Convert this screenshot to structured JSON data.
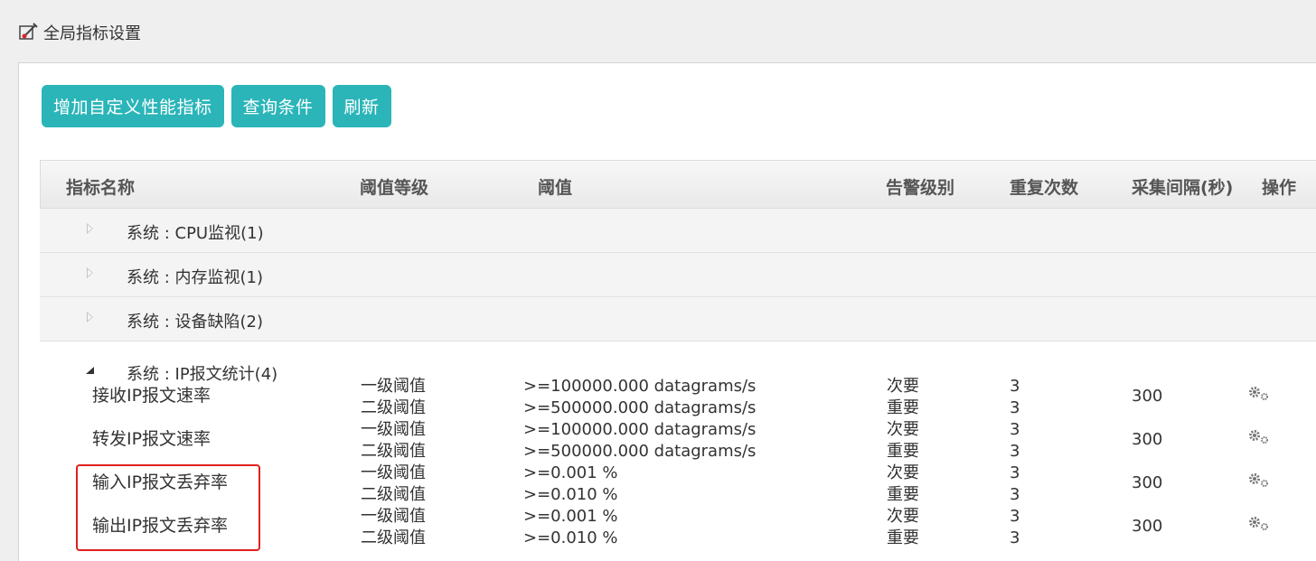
{
  "header": {
    "title": "全局指标设置",
    "icon": "edit-wrench-icon"
  },
  "toolbar": {
    "buttons": [
      {
        "label": "增加自定义性能指标"
      },
      {
        "label": "查询条件"
      },
      {
        "label": "刷新"
      }
    ]
  },
  "table": {
    "columns": [
      "指标名称",
      "阈值等级",
      "阈值",
      "告警级别",
      "重复次数",
      "采集间隔(秒)",
      "操作"
    ],
    "groups": [
      {
        "label": "系统 : CPU监视(1)",
        "expanded": false
      },
      {
        "label": "系统 : 内存监视(1)",
        "expanded": false
      },
      {
        "label": "系统 : 设备缺陷(2)",
        "expanded": false
      },
      {
        "label": "系统 : IP报文统计(4)",
        "expanded": true
      }
    ],
    "rows": [
      {
        "name": "接收IP报文速率",
        "levels": [
          "一级阈值",
          "二级阈值"
        ],
        "thresholds": [
          ">=100000.000 datagrams/s",
          ">=500000.000 datagrams/s"
        ],
        "alarms": [
          "次要",
          "重要"
        ],
        "repeats": [
          "3",
          "3"
        ],
        "interval": "300",
        "action_icon": "gear-icon"
      },
      {
        "name": "转发IP报文速率",
        "levels": [
          "一级阈值",
          "二级阈值"
        ],
        "thresholds": [
          ">=100000.000 datagrams/s",
          ">=500000.000 datagrams/s"
        ],
        "alarms": [
          "次要",
          "重要"
        ],
        "repeats": [
          "3",
          "3"
        ],
        "interval": "300",
        "action_icon": "gear-icon"
      },
      {
        "name": "输入IP报文丢弃率",
        "levels": [
          "一级阈值",
          "二级阈值"
        ],
        "thresholds": [
          ">=0.001 %",
          ">=0.010 %"
        ],
        "alarms": [
          "次要",
          "重要"
        ],
        "repeats": [
          "3",
          "3"
        ],
        "interval": "300",
        "action_icon": "gear-icon"
      },
      {
        "name": "输出IP报文丢弃率",
        "levels": [
          "一级阈值",
          "二级阈值"
        ],
        "thresholds": [
          ">=0.001 %",
          ">=0.010 %"
        ],
        "alarms": [
          "次要",
          "重要"
        ],
        "repeats": [
          "3",
          "3"
        ],
        "interval": "300",
        "action_icon": "gear-icon"
      }
    ]
  },
  "colors": {
    "button": "#2bb5b8",
    "highlight": "#e0201b"
  }
}
